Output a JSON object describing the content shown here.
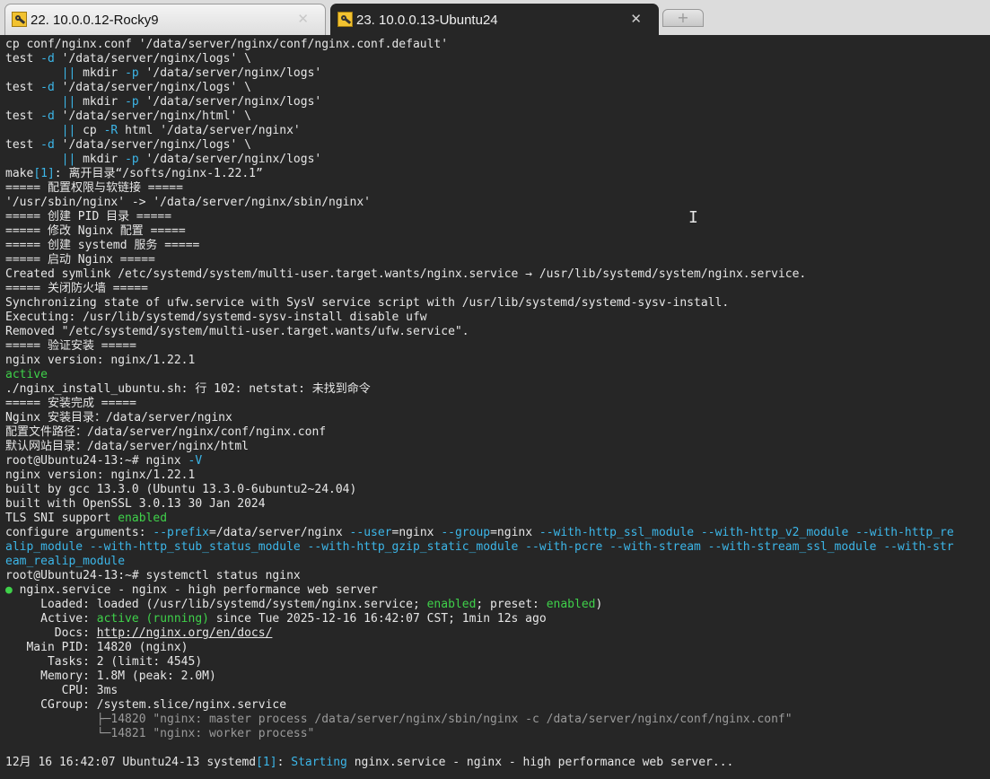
{
  "tabs": [
    {
      "label": "22. 10.0.0.12-Rocky9",
      "icon": "key-icon",
      "active": false
    },
    {
      "label": "23. 10.0.0.13-Ubuntu24",
      "icon": "key-icon",
      "active": true
    }
  ],
  "tab_close_glyph": "✕",
  "new_tab_glyph": "+",
  "colors": {
    "terminal_bg": "#262626",
    "text": "#e6e6e6",
    "green": "#3fd14a",
    "cyan": "#3cb6e8",
    "dim": "#9a9a9a"
  },
  "terminal": {
    "lines": [
      [
        {
          "t": "cp conf/nginx.conf '/data/server/nginx/conf/nginx.conf.default'"
        }
      ],
      [
        {
          "t": "test "
        },
        {
          "t": "-d",
          "c": "c"
        },
        {
          "t": " '/data/server/nginx/logs' \\"
        }
      ],
      [
        {
          "t": "        "
        },
        {
          "t": "||",
          "c": "c"
        },
        {
          "t": " mkdir "
        },
        {
          "t": "-p",
          "c": "c"
        },
        {
          "t": " '/data/server/nginx/logs'"
        }
      ],
      [
        {
          "t": "test "
        },
        {
          "t": "-d",
          "c": "c"
        },
        {
          "t": " '/data/server/nginx/logs' \\"
        }
      ],
      [
        {
          "t": "        "
        },
        {
          "t": "||",
          "c": "c"
        },
        {
          "t": " mkdir "
        },
        {
          "t": "-p",
          "c": "c"
        },
        {
          "t": " '/data/server/nginx/logs'"
        }
      ],
      [
        {
          "t": "test "
        },
        {
          "t": "-d",
          "c": "c"
        },
        {
          "t": " '/data/server/nginx/html' \\"
        }
      ],
      [
        {
          "t": "        "
        },
        {
          "t": "||",
          "c": "c"
        },
        {
          "t": " cp "
        },
        {
          "t": "-R",
          "c": "c"
        },
        {
          "t": " html '/data/server/nginx'"
        }
      ],
      [
        {
          "t": "test "
        },
        {
          "t": "-d",
          "c": "c"
        },
        {
          "t": " '/data/server/nginx/logs' \\"
        }
      ],
      [
        {
          "t": "        "
        },
        {
          "t": "||",
          "c": "c"
        },
        {
          "t": " mkdir "
        },
        {
          "t": "-p",
          "c": "c"
        },
        {
          "t": " '/data/server/nginx/logs'"
        }
      ],
      [
        {
          "t": "make"
        },
        {
          "t": "[1]",
          "c": "c"
        },
        {
          "t": ": 离开目录“/softs/nginx-1.22.1”"
        }
      ],
      [
        {
          "t": "===== 配置权限与软链接 ====="
        }
      ],
      [
        {
          "t": "'/usr/sbin/nginx' -> '/data/server/nginx/sbin/nginx'"
        }
      ],
      [
        {
          "t": "===== 创建 PID 目录 ====="
        }
      ],
      [
        {
          "t": "===== 修改 Nginx 配置 ====="
        }
      ],
      [
        {
          "t": "===== 创建 systemd 服务 ====="
        }
      ],
      [
        {
          "t": "===== 启动 Nginx ====="
        }
      ],
      [
        {
          "t": "Created symlink /etc/systemd/system/multi-user.target.wants/nginx.service → /usr/lib/systemd/system/nginx.service."
        }
      ],
      [
        {
          "t": "===== 关闭防火墙 ====="
        }
      ],
      [
        {
          "t": "Synchronizing state of ufw.service with SysV service script with /usr/lib/systemd/systemd-sysv-install."
        }
      ],
      [
        {
          "t": "Executing: /usr/lib/systemd/systemd-sysv-install disable ufw"
        }
      ],
      [
        {
          "t": "Removed \"/etc/systemd/system/multi-user.target.wants/ufw.service\"."
        }
      ],
      [
        {
          "t": "===== 验证安装 ====="
        }
      ],
      [
        {
          "t": "nginx version: nginx/1.22.1"
        }
      ],
      [
        {
          "t": "active",
          "c": "g"
        }
      ],
      [
        {
          "t": "./nginx_install_ubuntu.sh: 行 102: netstat: 未找到命令"
        }
      ],
      [
        {
          "t": "===== 安装完成 ====="
        }
      ],
      [
        {
          "t": "Nginx 安装目录：/data/server/nginx"
        }
      ],
      [
        {
          "t": "配置文件路径：/data/server/nginx/conf/nginx.conf"
        }
      ],
      [
        {
          "t": "默认网站目录：/data/server/nginx/html"
        }
      ],
      [
        {
          "t": "root@Ubuntu24-13:~# nginx "
        },
        {
          "t": "-V",
          "c": "c"
        }
      ],
      [
        {
          "t": "nginx version: nginx/1.22.1"
        }
      ],
      [
        {
          "t": "built by gcc 13.3.0 (Ubuntu 13.3.0-6ubuntu2~24.04)"
        }
      ],
      [
        {
          "t": "built with OpenSSL 3.0.13 30 Jan 2024"
        }
      ],
      [
        {
          "t": "TLS SNI support "
        },
        {
          "t": "enabled",
          "c": "g"
        }
      ],
      [
        {
          "t": "configure arguments: "
        },
        {
          "t": "--prefix",
          "c": "c"
        },
        {
          "t": "=/data/server/nginx "
        },
        {
          "t": "--user",
          "c": "c"
        },
        {
          "t": "=nginx "
        },
        {
          "t": "--group",
          "c": "c"
        },
        {
          "t": "=nginx "
        },
        {
          "t": "--with-http_ssl_module --with-http_v2_module --with-http_re",
          "c": "c"
        }
      ],
      [
        {
          "t": "alip_module ",
          "c": "c"
        },
        {
          "t": "--with-http_stub_status_module --with-http_gzip_static_module --with-pcre --with-stream --with-stream_ssl_module --with-str",
          "c": "c"
        }
      ],
      [
        {
          "t": "eam_realip_module",
          "c": "c"
        }
      ],
      [
        {
          "t": "root@Ubuntu24-13:~# systemctl status nginx"
        }
      ],
      [
        {
          "t": "●",
          "c": "g"
        },
        {
          "t": " nginx.service - nginx - high performance web server"
        }
      ],
      [
        {
          "t": "     Loaded: loaded (/usr/lib/systemd/system/nginx.service; "
        },
        {
          "t": "enabled",
          "c": "g"
        },
        {
          "t": "; preset: "
        },
        {
          "t": "enabled",
          "c": "g"
        },
        {
          "t": ")"
        }
      ],
      [
        {
          "t": "     Active: "
        },
        {
          "t": "active (running)",
          "c": "g"
        },
        {
          "t": " since Tue 2025-12-16 16:42:07 CST; 1min 12s ago"
        }
      ],
      [
        {
          "t": "       Docs: "
        },
        {
          "t": "http://nginx.org/en/docs/",
          "c": "u"
        }
      ],
      [
        {
          "t": "   Main PID: 14820 (nginx)"
        }
      ],
      [
        {
          "t": "      Tasks: 2 (limit: 4545)"
        }
      ],
      [
        {
          "t": "     Memory: 1.8M (peak: 2.0M)"
        }
      ],
      [
        {
          "t": "        CPU: 3ms"
        }
      ],
      [
        {
          "t": "     CGroup: /system.slice/nginx.service"
        }
      ],
      [
        {
          "t": "             ├─14820 \"nginx: master process /data/server/nginx/sbin/nginx -c /data/server/nginx/conf/nginx.conf\"",
          "c": "d"
        }
      ],
      [
        {
          "t": "             └─14821 \"nginx: worker process\"",
          "c": "d"
        }
      ],
      [
        {
          "t": ""
        }
      ],
      [
        {
          "t": "12月 16 16:42:07 Ubuntu24-13 systemd"
        },
        {
          "t": "[1]",
          "c": "c"
        },
        {
          "t": ": "
        },
        {
          "t": "Starting",
          "c": "c"
        },
        {
          "t": " nginx.service - nginx - high performance web server..."
        }
      ]
    ]
  }
}
